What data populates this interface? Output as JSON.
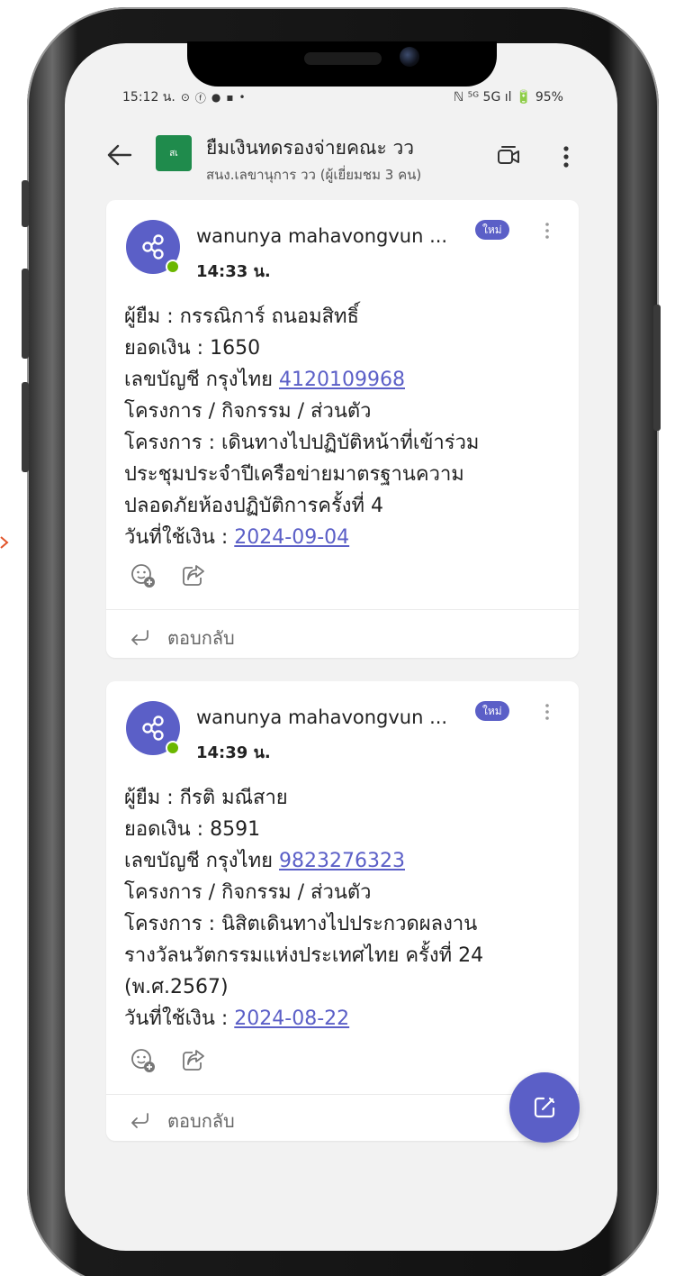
{
  "status_bar": {
    "time": "15:12 น.",
    "left_icons": [
      "⊙",
      "ⓕ",
      "●",
      "▪",
      "•"
    ],
    "right_text": "ℕ ⁵ᴳ 5G ıl 🔋 95%"
  },
  "header": {
    "team_avatar_text": "สเ",
    "title": "ยืมเงินทดรองจ่ายคณะ วว",
    "subtitle": "สนง.เลขานุการ วว (ผู้เยี่ยมชม 3 คน)"
  },
  "messages": [
    {
      "sender": "wanunya mahavongvun ...",
      "badge": "ใหม่",
      "time": "14:33 น.",
      "lines": [
        "ผู้ยืม : กรรณิการ์ ถนอมสิทธิ์",
        " ยอดเงิน : 1650",
        " เลขบัญชี กรุงไทย ",
        " โครงการ / กิจกรรม / ส่วนตัว",
        " โครงการ : เดินทางไปปฏิบัติหน้าที่เข้าร่วม",
        "ประชุมประจำปีเครือข่ายมาตรฐานความ",
        "ปลอดภัยห้องปฏิบัติการครั้งที่ 4",
        " วันที่ใช้เงิน : "
      ],
      "account_link": "4120109968",
      "date_link": "2024-09-04",
      "reply_label": "ตอบกลับ"
    },
    {
      "sender": "wanunya mahavongvun ...",
      "badge": "ใหม่",
      "time": "14:39 น.",
      "lines": [
        "ผู้ยืม : กีรติ มณีสาย",
        " ยอดเงิน : 8591",
        " เลขบัญชี กรุงไทย ",
        " โครงการ / กิจกรรม / ส่วนตัว",
        " โครงการ : นิสิตเดินทางไปประกวดผลงาน",
        "รางวัลนวัตกรรมแห่งประเทศไทย ครั้งที่ 24",
        "(พ.ศ.2567)",
        " วันที่ใช้เงิน : "
      ],
      "account_link": "9823276323",
      "date_link": "2024-08-22",
      "reply_label": "ตอบกลับ"
    }
  ],
  "colors": {
    "accent": "#5b5fc7",
    "presence": "#6bb700",
    "team_avatar": "#1f8b4c"
  }
}
